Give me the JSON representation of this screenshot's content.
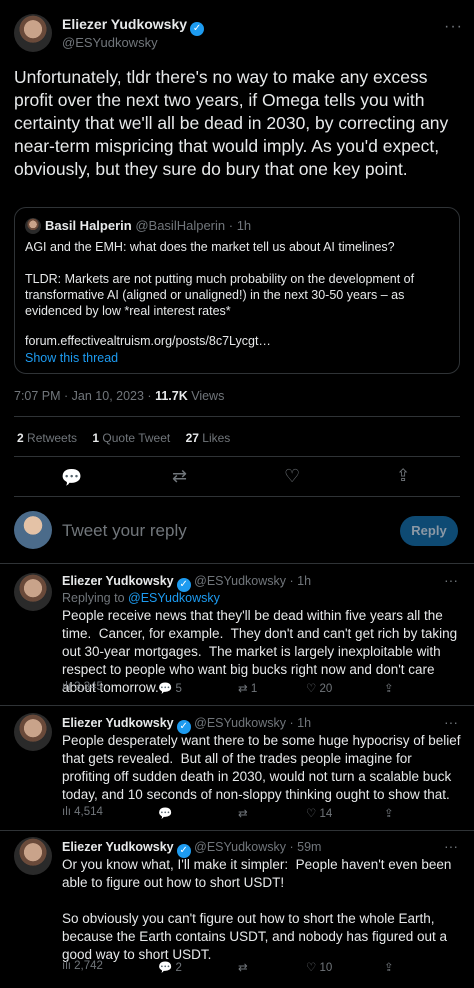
{
  "main_tweet": {
    "author_name": "Eliezer Yudkowsky",
    "handle": "@ESYudkowsky",
    "text": "Unfortunately, tldr there's no way to make any excess profit over the next two years, if Omega tells you with certainty that we'll all be dead in 2030, by correcting any near-term mispricing that would imply.  As you'd expect, obviously, but they sure do bury that one key point.",
    "quote": {
      "author_name": "Basil Halperin",
      "handle": "@BasilHalperin",
      "time": "· 1h",
      "line1": "AGI and the EMH: what does the market tell us about AI timelines?",
      "line2": "TLDR: Markets are not putting much probability on the development of transformative AI (aligned or unaligned!) in the next 30-50 years – as evidenced by low *real interest rates*",
      "link": "forum.effectivealtruism.org/posts/8c7Lycgt…",
      "show_thread": "Show this thread"
    },
    "timestamp": "7:07 PM · Jan 10, 2023 · ",
    "views_count": "11.7K",
    "views_label": " Views",
    "stats": {
      "retweets_count": "2",
      "retweets_label": " Retweets",
      "quotes_count": "1",
      "quotes_label": " Quote Tweet",
      "likes_count": "27",
      "likes_label": " Likes"
    }
  },
  "compose": {
    "placeholder": "Tweet your reply",
    "reply_button": "Reply"
  },
  "replies": [
    {
      "author_name": "Eliezer Yudkowsky",
      "handle": "@ESYudkowsky",
      "time": "· 1h",
      "replying_to_prefix": "Replying to ",
      "replying_to": "@ESYudkowsky",
      "text": "People receive news that they'll be dead within five years all the time.  Cancer, for example.  They don't and can't get rich by taking out 30-year mortgages.  The market is largely inexploitable with respect to people who want big bucks right now and don't care about tomorrow.",
      "views": "3,345",
      "replies": "5",
      "retweets": "1",
      "likes": "20"
    },
    {
      "author_name": "Eliezer Yudkowsky",
      "handle": "@ESYudkowsky",
      "time": "· 1h",
      "text": "People desperately want there to be some huge hypocrisy of belief that gets revealed.  But all of the trades people imagine for profiting off sudden death in 2030, would not turn a scalable buck today, and 10 seconds of non-sloppy thinking ought to show that.",
      "views": "4,514",
      "likes": "14"
    },
    {
      "author_name": "Eliezer Yudkowsky",
      "handle": "@ESYudkowsky",
      "time": "· 59m",
      "text": "Or you know what, I'll make it simpler:  People haven't even been able to figure out how to short USDT!\n\nSo obviously you can't figure out how to short the whole Earth, because the Earth contains USDT, and nobody has figured out a good way to short USDT.",
      "views": "2,742",
      "replies": "2",
      "likes": "10"
    }
  ]
}
